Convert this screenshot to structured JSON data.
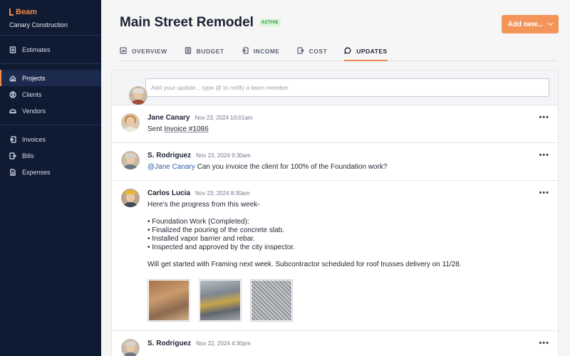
{
  "brand": {
    "logo_text": "Beam",
    "company": "Canary Construction",
    "accent": "#f08a4b"
  },
  "sidebar": {
    "groups": [
      [
        {
          "label": "Estimates",
          "icon": "estimates-icon"
        }
      ],
      [
        {
          "label": "Projects",
          "icon": "home-icon",
          "active": true
        },
        {
          "label": "Clients",
          "icon": "client-icon"
        },
        {
          "label": "Vendors",
          "icon": "vendor-icon"
        }
      ],
      [
        {
          "label": "Invoices",
          "icon": "invoice-icon"
        },
        {
          "label": "Bills",
          "icon": "bill-icon"
        },
        {
          "label": "Expenses",
          "icon": "expense-icon"
        }
      ]
    ]
  },
  "header": {
    "title": "Main Street Remodel",
    "status": "ACTIVE",
    "add_button": "Add new...",
    "tabs": [
      {
        "label": "OVERVIEW",
        "icon": "chart-icon"
      },
      {
        "label": "BUDGET",
        "icon": "budget-icon"
      },
      {
        "label": "INCOME",
        "icon": "income-icon"
      },
      {
        "label": "COST",
        "icon": "cost-icon"
      },
      {
        "label": "UPDATES",
        "icon": "chat-icon",
        "active": true
      }
    ]
  },
  "compose": {
    "placeholder": "Add your update... type @ to notify a team member"
  },
  "posts": [
    {
      "author": "Jane Canary",
      "time": "Nov 23, 2024 10:01am",
      "prefix": "Sent ",
      "link": "Invoice #1086"
    },
    {
      "author": "S. Rodriguez",
      "time": "Nov 23, 2024 9:30am",
      "mention": "@Jane Canary",
      "text": " Can you invoice the client for 100% of the Foundation work?"
    },
    {
      "author": "Carlos Lucia",
      "time": "Nov 23, 2024 8:30am",
      "lines": [
        "Here's the progress from this week-",
        "",
        "• Foundation Work (Completed):",
        "• Finalized the pouring of the concrete slab.",
        "• Installed vapor barrier and rebar.",
        "• Inspected and approved by the city inspector.",
        "",
        "Will get started with Framing next week. Subcontractor scheduled for roof trusses delivery on 11/28."
      ],
      "photos": [
        "foundation-forms-photo",
        "concrete-slab-photo",
        "rebar-grid-photo"
      ]
    },
    {
      "author": "S. Rodriguez",
      "time": "Nov 22, 2024 4:30pm"
    }
  ]
}
